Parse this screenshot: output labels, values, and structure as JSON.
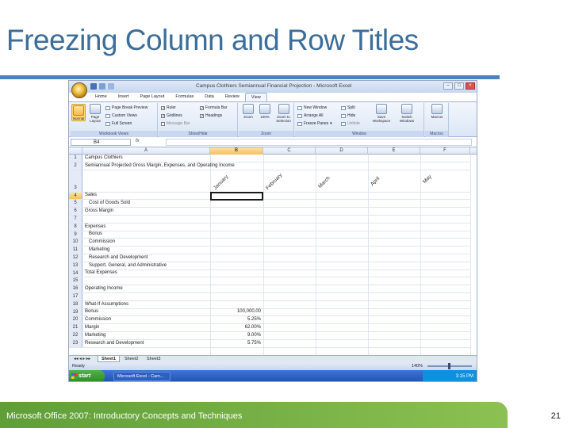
{
  "slide": {
    "title": "Freezing Column and Row Titles",
    "footer": "Microsoft Office 2007: Introductory Concepts and Techniques",
    "page_number": "21"
  },
  "excel": {
    "window_title": "Campus Clothiers Semiannual Financial Projection - Microsoft Excel",
    "tabs": [
      "Home",
      "Insert",
      "Page Layout",
      "Formulas",
      "Data",
      "Review",
      "View"
    ],
    "active_tab": "View",
    "ribbon": {
      "workbook_views": {
        "label": "Workbook Views",
        "normal": "Normal",
        "page_layout": "Page Layout",
        "page_break_preview": "Page Break Preview",
        "custom_views": "Custom Views",
        "full_screen": "Full Screen"
      },
      "show_hide": {
        "label": "Show/Hide",
        "ruler": "Ruler",
        "gridlines": "Gridlines",
        "message_bar": "Message Bar",
        "formula_bar": "Formula Bar",
        "headings": "Headings"
      },
      "zoom": {
        "label": "Zoom",
        "zoom": "Zoom",
        "hundred": "100%",
        "zoom_to_selection": "Zoom to Selection"
      },
      "window": {
        "label": "Window",
        "new_window": "New Window",
        "arrange_all": "Arrange All",
        "freeze_panes": "Freeze Panes",
        "split": "Split",
        "hide": "Hide",
        "unhide": "Unhide",
        "save_workspace": "Save Workspace",
        "switch_windows": "Switch Windows"
      },
      "macros": {
        "label": "Macros",
        "macros": "Macros"
      }
    },
    "name_box": "B4",
    "fx": "fx",
    "columns": [
      "A",
      "B",
      "C",
      "D",
      "E",
      "F"
    ],
    "months": [
      "January",
      "February",
      "March",
      "April",
      "May"
    ],
    "rows": [
      {
        "n": "1",
        "a": "Campus Clothiers",
        "b": ""
      },
      {
        "n": "2",
        "a": "Semiannual Projected Gross Margin, Expenses, and Operating Income",
        "b": ""
      },
      {
        "n": "3",
        "a": "",
        "b": ""
      },
      {
        "n": "4",
        "a": "Sales",
        "b": ""
      },
      {
        "n": "5",
        "a": "   Cost of Goods Sold",
        "b": ""
      },
      {
        "n": "6",
        "a": "Gross Margin",
        "b": ""
      },
      {
        "n": "7",
        "a": "",
        "b": ""
      },
      {
        "n": "8",
        "a": "Expenses",
        "b": ""
      },
      {
        "n": "9",
        "a": "   Bonus",
        "b": ""
      },
      {
        "n": "10",
        "a": "   Commission",
        "b": ""
      },
      {
        "n": "11",
        "a": "   Marketing",
        "b": ""
      },
      {
        "n": "12",
        "a": "   Research and Development",
        "b": ""
      },
      {
        "n": "13",
        "a": "   Support, General, and Administrative",
        "b": ""
      },
      {
        "n": "14",
        "a": "Total Expenses",
        "b": ""
      },
      {
        "n": "15",
        "a": "",
        "b": ""
      },
      {
        "n": "16",
        "a": "Operating Income",
        "b": ""
      },
      {
        "n": "17",
        "a": "",
        "b": ""
      },
      {
        "n": "18",
        "a": "What-If Assumptions",
        "b": ""
      },
      {
        "n": "19",
        "a": "Bonus",
        "b": "100,000.00"
      },
      {
        "n": "20",
        "a": "Commission",
        "b": "5.25%"
      },
      {
        "n": "21",
        "a": "Margin",
        "b": "62.00%"
      },
      {
        "n": "22",
        "a": "Marketing",
        "b": "9.00%"
      },
      {
        "n": "23",
        "a": "Research and Development",
        "b": "5.75%"
      }
    ],
    "sheet_tabs": [
      "Sheet1",
      "Sheet2",
      "Sheet3"
    ],
    "status": "Ready",
    "zoom_level": "140%",
    "taskbar": {
      "start": "start",
      "item": "Microsoft Excel - Cam...",
      "clock": "3:15 PM"
    }
  }
}
